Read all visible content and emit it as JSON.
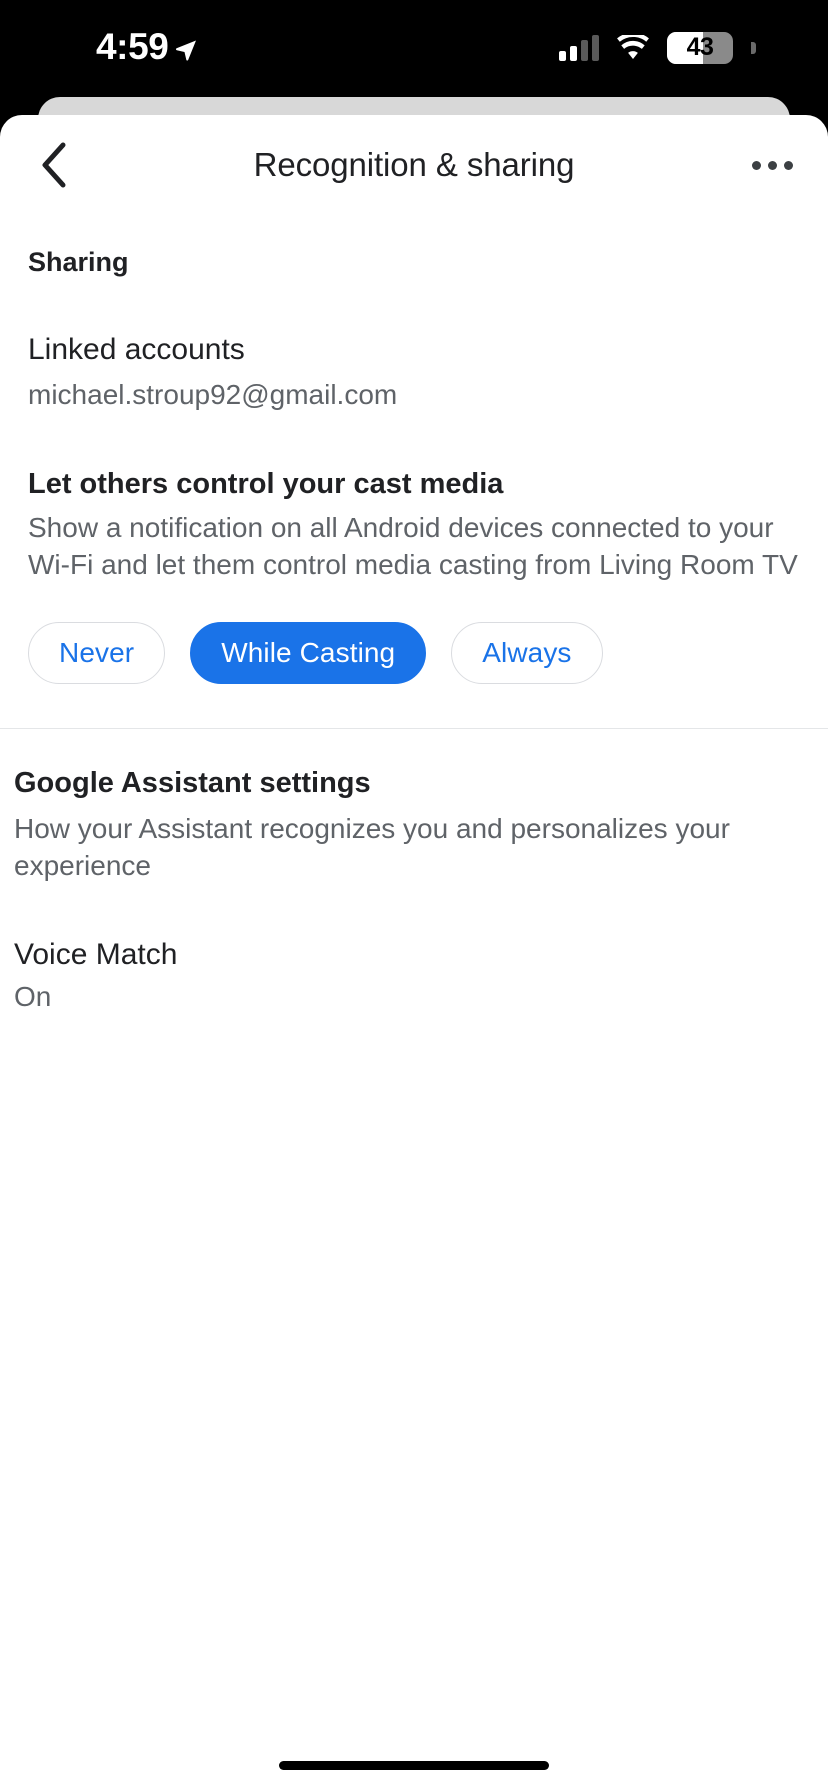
{
  "status_bar": {
    "time": "4:59",
    "location_icon": "location-arrow-icon",
    "signal_icon": "cellular-signal-icon",
    "wifi_icon": "wifi-icon",
    "battery_percent": "43",
    "battery_icon": "battery-icon"
  },
  "appbar": {
    "back_icon": "back-chevron-icon",
    "title": "Recognition & sharing",
    "overflow_icon": "overflow-menu-icon"
  },
  "sharing": {
    "section_label": "Sharing",
    "linked_accounts": {
      "title": "Linked accounts",
      "value": "michael.stroup92@gmail.com"
    },
    "cast_media": {
      "title": "Let others control your cast media",
      "description": "Show a notification on all Android devices connected to your Wi-Fi and let them control media casting from Living Room TV",
      "options": [
        {
          "label": "Never",
          "selected": false
        },
        {
          "label": "While Casting",
          "selected": true
        },
        {
          "label": "Always",
          "selected": false
        }
      ]
    }
  },
  "assistant": {
    "title": "Google Assistant settings",
    "description": "How your Assistant recognizes you and personalizes your experience",
    "voice_match": {
      "title": "Voice Match",
      "value": "On"
    }
  },
  "colors": {
    "accent": "#1a73e8",
    "text_primary": "#202124",
    "text_secondary": "#5f6368",
    "divider": "#e4e6e8",
    "sheet_bg": "#ffffff",
    "system_bg": "#000000"
  }
}
